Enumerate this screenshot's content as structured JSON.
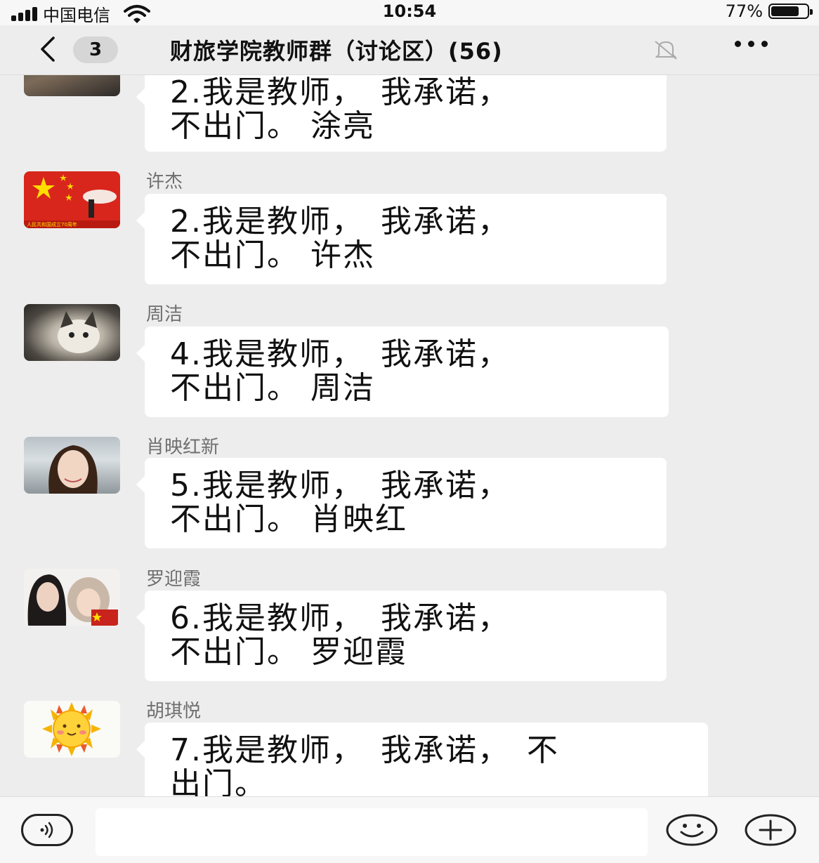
{
  "status_bar": {
    "carrier": "中国电信",
    "time": "10:54",
    "battery": "77%",
    "battery_level": 0.77
  },
  "header": {
    "back_count": "3",
    "title": "财旅学院教师群（讨论区）(56)"
  },
  "messages": [
    {
      "sender": "",
      "line1": "2.我是教师，　我承诺，",
      "line2": "不出门。 涂亮"
    },
    {
      "sender": "许杰",
      "line1": "2.我是教师，　我承诺，",
      "line2": "不出门。 许杰",
      "avatar_text": "人民共和国成立70周年"
    },
    {
      "sender": "周洁",
      "line1": "4.我是教师，　我承诺，",
      "line2": "不出门。 周洁"
    },
    {
      "sender": "肖映红新",
      "line1": "5.我是教师，　我承诺，",
      "line2": "不出门。 肖映红"
    },
    {
      "sender": "罗迎霞",
      "line1": "6.我是教师，　我承诺，",
      "line2": "不出门。 罗迎霞"
    },
    {
      "sender": "胡琪悦",
      "line1": "7.我是教师，　我承诺，　不",
      "line2": "出门。"
    }
  ],
  "input": {
    "placeholder": ""
  },
  "colors": {
    "background": "#ededed",
    "bubble": "#ffffff",
    "sender": "#6f6f6f"
  },
  "icons": {
    "back": "chevron-left-icon",
    "mute": "bell-off-icon",
    "more": "more-dots-icon",
    "voice": "voice-icon",
    "emoji": "smiley-icon",
    "plus": "plus-circle-icon"
  }
}
